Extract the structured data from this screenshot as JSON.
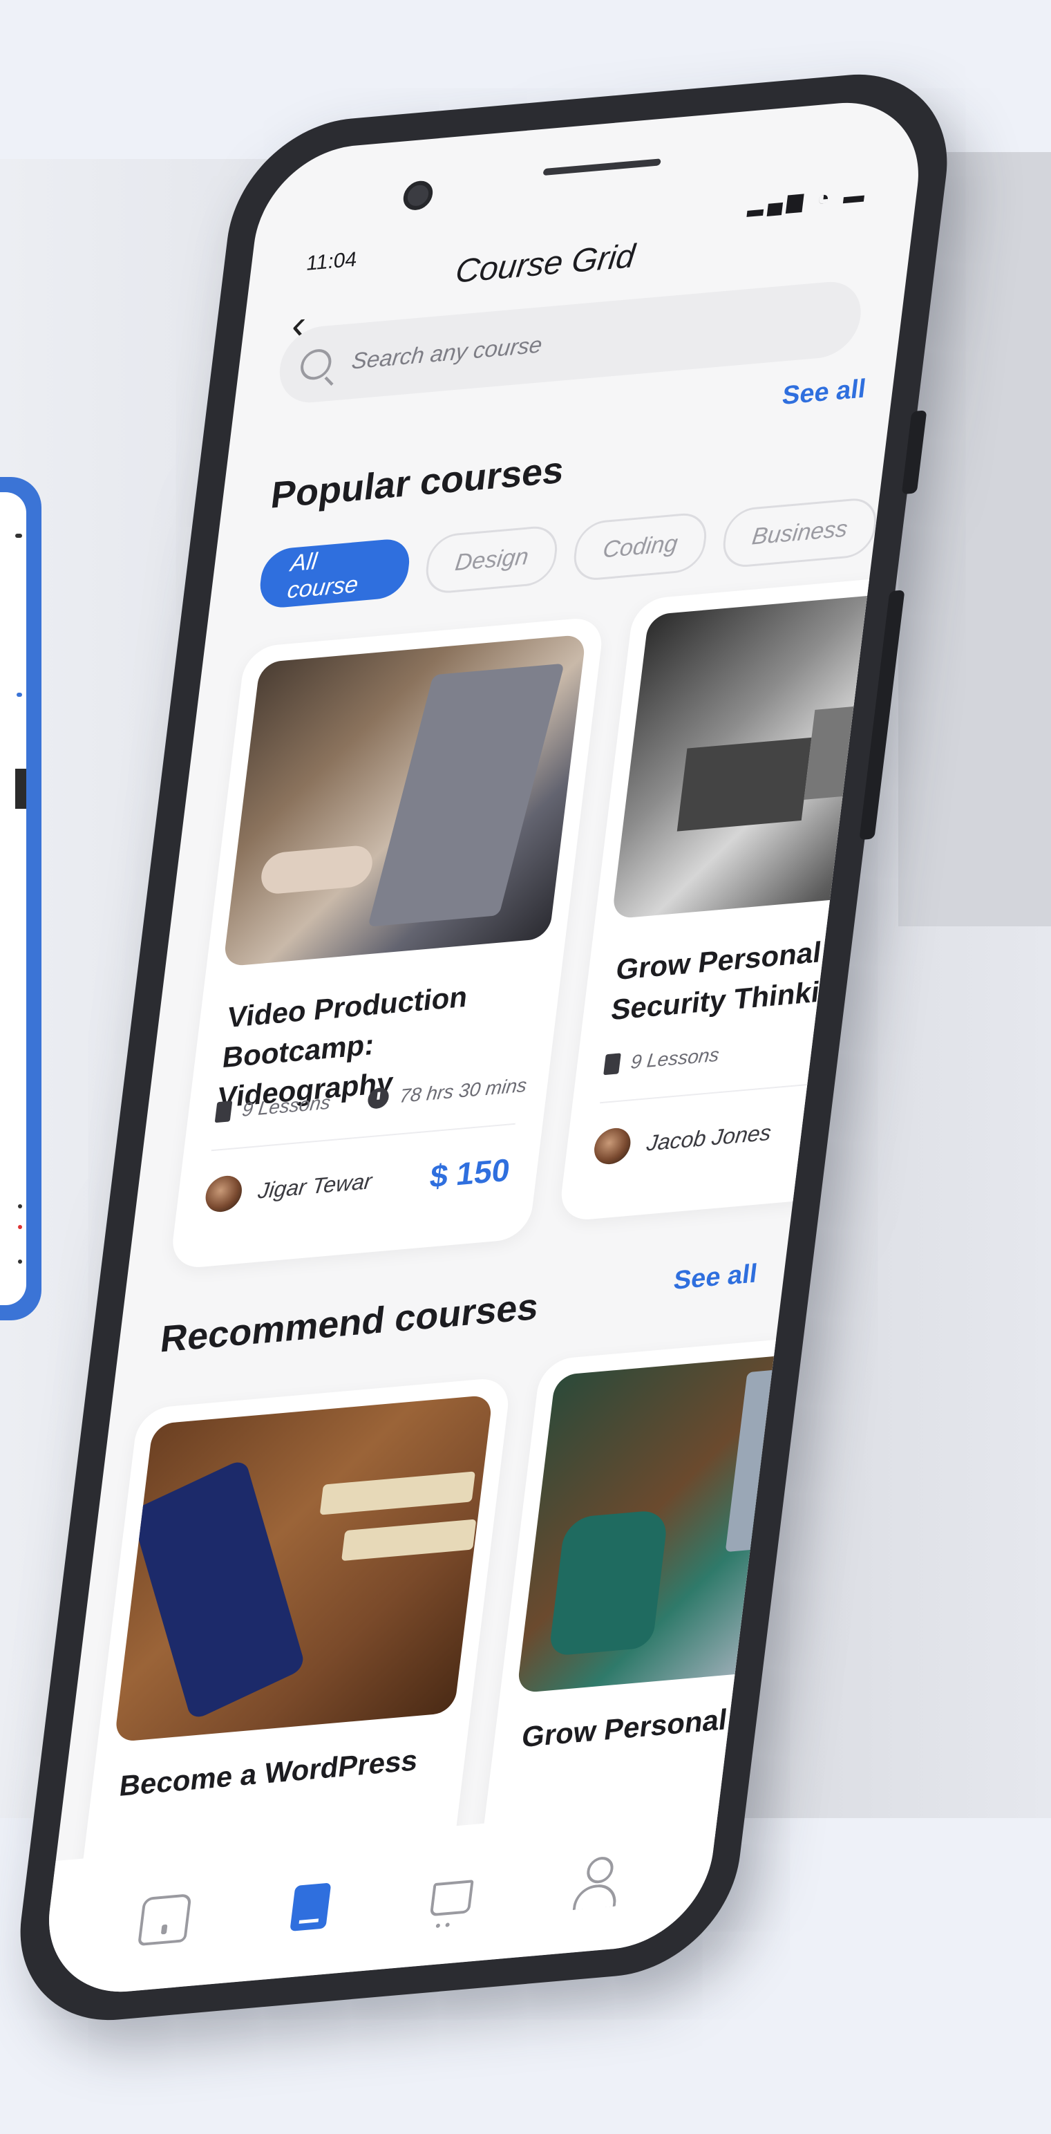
{
  "status_bar": {
    "time": "11:04",
    "icons": "▂▄▆ ◔ ▬"
  },
  "header": {
    "back_icon": "chevron-left-icon",
    "title": "Course Grid"
  },
  "search": {
    "placeholder": "Search any course",
    "icon": "search-icon"
  },
  "popular": {
    "title": "Popular courses",
    "see_all": "See all",
    "chips": [
      "All course",
      "Design",
      "Coding",
      "Business"
    ],
    "active_chip": "All course",
    "cards": [
      {
        "title_line1": "Video Production",
        "title_line2": "Bootcamp: Videography",
        "lessons": "9 Lessons",
        "duration": "78 hrs 30 mins",
        "author": "Jigar Tewar",
        "price": "$ 150"
      },
      {
        "title_line1": "Grow Personal Fir",
        "title_line2": "Security Thinking",
        "lessons": "9 Lessons",
        "duration": "",
        "author": "Jacob Jones",
        "price": ""
      }
    ]
  },
  "recommend": {
    "title": "Recommend courses",
    "see_all": "See all",
    "cards": [
      {
        "title": "Become a WordPress"
      },
      {
        "title": "Grow Personal Fir"
      }
    ]
  },
  "tabbar": {
    "items": [
      {
        "icon": "home-icon",
        "active": false
      },
      {
        "icon": "courses-icon",
        "active": true
      },
      {
        "icon": "cart-icon",
        "active": false
      },
      {
        "icon": "profile-icon",
        "active": false
      }
    ]
  },
  "colors": {
    "accent": "#2f6fde",
    "phone_body": "#2b2c31",
    "background": "#eef1f8"
  }
}
